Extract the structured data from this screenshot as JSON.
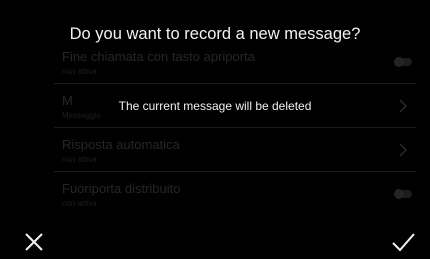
{
  "dialog": {
    "title": "Do you want to record a new message?",
    "message": "The current message will be deleted",
    "cancel_icon": "close-icon",
    "confirm_icon": "check-icon"
  },
  "background_list": {
    "items": [
      {
        "label": "Fine chiamata con tasto apriporta",
        "status": "non attiva",
        "control": "toggle-icon"
      },
      {
        "label": "M",
        "status": "Messaggio",
        "control": "chevron-right-icon"
      },
      {
        "label": "Risposta automatica",
        "status": "non attiva",
        "control": "chevron-right-icon"
      },
      {
        "label": "Fuoriporta distribuito",
        "status": "non attiva",
        "control": "toggle-icon"
      }
    ]
  },
  "colors": {
    "background": "#000000",
    "text": "#f2f2f2",
    "dimmed_text": "#262626"
  }
}
